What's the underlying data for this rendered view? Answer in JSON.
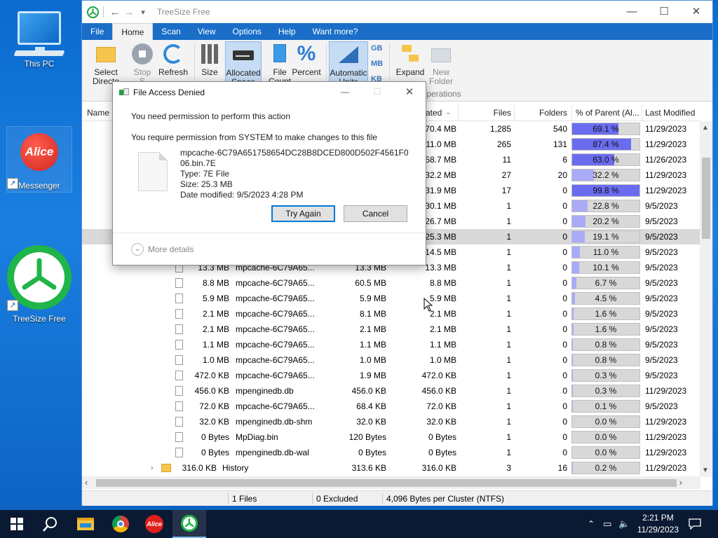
{
  "desktop": {
    "icons": [
      {
        "label": "This PC"
      },
      {
        "label": "Messenger",
        "logo_text": "Alice"
      },
      {
        "label": "TreeSize Free"
      }
    ]
  },
  "window": {
    "title": "TreeSize Free",
    "quick_access": {
      "back": "←",
      "forward": "→",
      "dropdown": "▾"
    },
    "controls": {
      "minimize": "—",
      "maximize": "☐",
      "close": "✕"
    },
    "menu_tabs": [
      "File",
      "Home",
      "Scan",
      "View",
      "Options",
      "Help",
      "Want more?"
    ],
    "active_tab": "Home",
    "ribbon": {
      "buttons": [
        {
          "l1": "Select",
          "l2": "Directo",
          "state": "normal"
        },
        {
          "l1": "Stop",
          "l2": "S",
          "state": "disabled"
        },
        {
          "l1": "Refresh",
          "l2": "",
          "state": "normal"
        },
        {
          "l1": "Size",
          "l2": "",
          "state": "normal"
        },
        {
          "l1": "Allocated",
          "l2": "Space",
          "state": "pressed"
        },
        {
          "l1": "File",
          "l2": "Count",
          "state": "normal"
        },
        {
          "l1": "Percent",
          "l2": "",
          "state": "normal"
        },
        {
          "l1": "Automatic",
          "l2": "Units",
          "state": "pressed"
        },
        {
          "l1": "Expand",
          "l2": "",
          "state": "normal"
        },
        {
          "l1": "New",
          "l2": "Folder",
          "state": "disabled"
        }
      ],
      "unit_labels": [
        "GB",
        "MB",
        "KB"
      ],
      "group_label": "Operations"
    },
    "columns": {
      "name": "Name",
      "allocated": "ated",
      "files": "Files",
      "folders": "Folders",
      "percent": "% of Parent (Al...",
      "modified": "Last Modified"
    },
    "rows": [
      {
        "size": "",
        "name": "",
        "total": "",
        "alloc": "70.4 MB",
        "files": "1,285",
        "folders": "540",
        "pct": "69.1 %",
        "pct_val": 69.1,
        "modified": "11/29/2023",
        "kind": "hidden"
      },
      {
        "size": "",
        "name": "",
        "total": "",
        "alloc": "11.0 MB",
        "files": "265",
        "folders": "131",
        "pct": "87.4 %",
        "pct_val": 87.4,
        "modified": "11/29/2023",
        "kind": "hidden"
      },
      {
        "size": "",
        "name": "",
        "total": "",
        "alloc": "58.7 MB",
        "files": "11",
        "folders": "6",
        "pct": "63.0 %",
        "pct_val": 63.0,
        "modified": "11/26/2023",
        "kind": "hidden"
      },
      {
        "size": "",
        "name": "",
        "total": "",
        "alloc": "32.2 MB",
        "files": "27",
        "folders": "20",
        "pct": "32.2 %",
        "pct_val": 32.2,
        "modified": "11/29/2023",
        "kind": "hidden"
      },
      {
        "size": "",
        "name": "",
        "total": "",
        "alloc": "31.9 MB",
        "files": "17",
        "folders": "0",
        "pct": "99.8 %",
        "pct_val": 99.8,
        "modified": "11/29/2023",
        "kind": "hidden"
      },
      {
        "size": "",
        "name": "",
        "total": "",
        "alloc": "30.1 MB",
        "files": "1",
        "folders": "0",
        "pct": "22.8 %",
        "pct_val": 22.8,
        "modified": "9/5/2023",
        "kind": "hidden"
      },
      {
        "size": "",
        "name": "",
        "total": "",
        "alloc": "26.7 MB",
        "files": "1",
        "folders": "0",
        "pct": "20.2 %",
        "pct_val": 20.2,
        "modified": "9/5/2023",
        "kind": "hidden"
      },
      {
        "size": "",
        "name": "",
        "total": "",
        "alloc": "25.3 MB",
        "files": "1",
        "folders": "0",
        "pct": "19.1 %",
        "pct_val": 19.1,
        "modified": "9/5/2023",
        "kind": "hidden",
        "selected": true
      },
      {
        "size": "",
        "name": "",
        "total": "",
        "alloc": "14.5 MB",
        "files": "1",
        "folders": "0",
        "pct": "11.0 %",
        "pct_val": 11.0,
        "modified": "9/5/2023",
        "kind": "hidden"
      },
      {
        "size": "13.3 MB",
        "name": "mpcache-6C79A65...",
        "total": "13.3 MB",
        "alloc": "13.3 MB",
        "files": "1",
        "folders": "0",
        "pct": "10.1 %",
        "pct_val": 10.1,
        "modified": "9/5/2023",
        "kind": "file"
      },
      {
        "size": "8.8 MB",
        "name": "mpcache-6C79A65...",
        "total": "60.5 MB",
        "alloc": "8.8 MB",
        "files": "1",
        "folders": "0",
        "pct": "6.7 %",
        "pct_val": 6.7,
        "modified": "9/5/2023",
        "kind": "file"
      },
      {
        "size": "5.9 MB",
        "name": "mpcache-6C79A65...",
        "total": "5.9 MB",
        "alloc": "5.9 MB",
        "files": "1",
        "folders": "0",
        "pct": "4.5 %",
        "pct_val": 4.5,
        "modified": "9/5/2023",
        "kind": "file"
      },
      {
        "size": "2.1 MB",
        "name": "mpcache-6C79A65...",
        "total": "8.1 MB",
        "alloc": "2.1 MB",
        "files": "1",
        "folders": "0",
        "pct": "1.6 %",
        "pct_val": 1.6,
        "modified": "9/5/2023",
        "kind": "file"
      },
      {
        "size": "2.1 MB",
        "name": "mpcache-6C79A65...",
        "total": "2.1 MB",
        "alloc": "2.1 MB",
        "files": "1",
        "folders": "0",
        "pct": "1.6 %",
        "pct_val": 1.6,
        "modified": "9/5/2023",
        "kind": "file"
      },
      {
        "size": "1.1 MB",
        "name": "mpcache-6C79A65...",
        "total": "1.1 MB",
        "alloc": "1.1 MB",
        "files": "1",
        "folders": "0",
        "pct": "0.8 %",
        "pct_val": 0.8,
        "modified": "9/5/2023",
        "kind": "file"
      },
      {
        "size": "1.0 MB",
        "name": "mpcache-6C79A65...",
        "total": "1.0 MB",
        "alloc": "1.0 MB",
        "files": "1",
        "folders": "0",
        "pct": "0.8 %",
        "pct_val": 0.8,
        "modified": "9/5/2023",
        "kind": "file"
      },
      {
        "size": "472.0 KB",
        "name": "mpcache-6C79A65...",
        "total": "1.9 MB",
        "alloc": "472.0 KB",
        "files": "1",
        "folders": "0",
        "pct": "0.3 %",
        "pct_val": 0.3,
        "modified": "9/5/2023",
        "kind": "file"
      },
      {
        "size": "456.0 KB",
        "name": "mpenginedb.db",
        "total": "456.0 KB",
        "alloc": "456.0 KB",
        "files": "1",
        "folders": "0",
        "pct": "0.3 %",
        "pct_val": 0.3,
        "modified": "11/29/2023",
        "kind": "file"
      },
      {
        "size": "72.0 KB",
        "name": "mpcache-6C79A65...",
        "total": "68.4 KB",
        "alloc": "72.0 KB",
        "files": "1",
        "folders": "0",
        "pct": "0.1 %",
        "pct_val": 0.1,
        "modified": "9/5/2023",
        "kind": "file"
      },
      {
        "size": "32.0 KB",
        "name": "mpenginedb.db-shm",
        "total": "32.0 KB",
        "alloc": "32.0 KB",
        "files": "1",
        "folders": "0",
        "pct": "0.0 %",
        "pct_val": 0.0,
        "modified": "11/29/2023",
        "kind": "file"
      },
      {
        "size": "0 Bytes",
        "name": "MpDiag.bin",
        "total": "120 Bytes",
        "alloc": "0 Bytes",
        "files": "1",
        "folders": "0",
        "pct": "0.0 %",
        "pct_val": 0.0,
        "modified": "11/29/2023",
        "kind": "file"
      },
      {
        "size": "0 Bytes",
        "name": "mpenginedb.db-wal",
        "total": "0 Bytes",
        "alloc": "0 Bytes",
        "files": "1",
        "folders": "0",
        "pct": "0.0 %",
        "pct_val": 0.0,
        "modified": "11/29/2023",
        "kind": "file"
      },
      {
        "size": "316.0 KB",
        "name": "History",
        "total": "313.6 KB",
        "alloc": "316.0 KB",
        "files": "3",
        "folders": "16",
        "pct": "0.2 %",
        "pct_val": 0.2,
        "modified": "11/29/2023",
        "kind": "folder"
      }
    ],
    "status": {
      "files": "1 Files",
      "excluded": "0 Excluded",
      "cluster": "4,096 Bytes per Cluster (NTFS)"
    }
  },
  "dialog": {
    "title": "File Access Denied",
    "message": "You need permission to perform this action",
    "detail": "You require permission from SYSTEM to make changes to this file",
    "file_name": "mpcache-6C79A651758654DC28B8DCED800D502F4561F006.bin.7E",
    "file_type": "Type: 7E File",
    "file_size": "Size: 25.3 MB",
    "file_date": "Date modified: 9/5/2023 4:28 PM",
    "try_again": "Try Again",
    "cancel": "Cancel",
    "more_details": "More details",
    "close": "✕",
    "maximize": "☐",
    "minimize": "—"
  },
  "taskbar": {
    "apps": [
      "start",
      "search",
      "file-explorer",
      "chrome",
      "alice",
      "treesize"
    ],
    "alice_text": "Alice",
    "time": "2:21 PM",
    "date": "11/29/2023"
  },
  "colors": {
    "accent": "#1a6ec8",
    "bar_high": "#6a6cf0",
    "bar_low": "#a9abf6"
  }
}
